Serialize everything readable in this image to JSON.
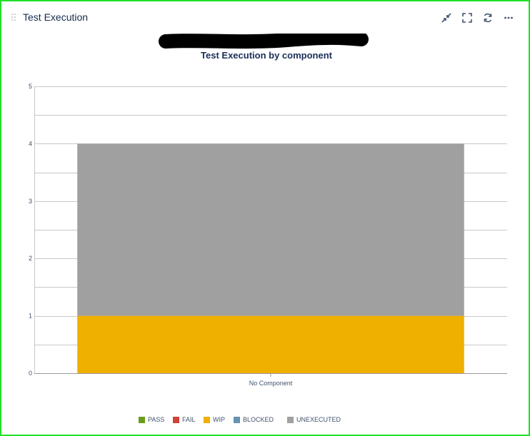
{
  "panel": {
    "title": "Test Execution",
    "icons": [
      "collapse-icon",
      "fullscreen-icon",
      "refresh-icon",
      "more-icon"
    ]
  },
  "chart_data": {
    "type": "bar",
    "stacked": true,
    "title": "Test Execution by component",
    "xlabel": "",
    "ylabel": "",
    "categories": [
      "No Component"
    ],
    "ylim": [
      0,
      5
    ],
    "yticks": [
      "0",
      "1",
      "2",
      "3",
      "4",
      "5"
    ],
    "grid": true,
    "legend_position": "bottom",
    "series": [
      {
        "name": "PASS",
        "values": [
          0
        ],
        "color": "#6b9c1a"
      },
      {
        "name": "FAIL",
        "values": [
          0
        ],
        "color": "#d04437"
      },
      {
        "name": "WIP",
        "values": [
          1
        ],
        "color": "#f0b000"
      },
      {
        "name": "BLOCKED",
        "values": [
          0
        ],
        "color": "#6693b0"
      },
      {
        "name": "UNEXECUTED",
        "values": [
          3
        ],
        "color": "#a0a0a0"
      }
    ]
  }
}
